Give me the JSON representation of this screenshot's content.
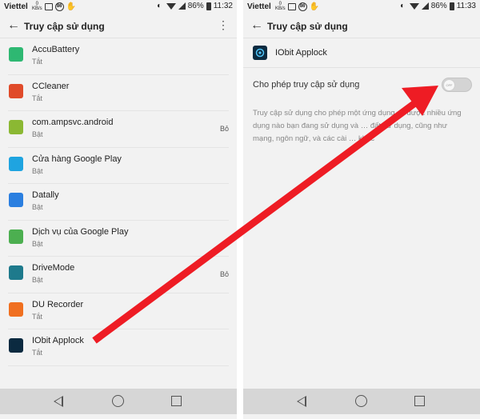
{
  "left_screen": {
    "status": {
      "carrier": "Viettel",
      "speed_value": "0",
      "speed_unit": "KB/s",
      "battery": "86%",
      "time": "11:32"
    },
    "toolbar": {
      "title": "Truy cập sử dụng",
      "menu_glyph": "⋮"
    },
    "apps": [
      {
        "name": "AccuBattery",
        "status": "Tắt",
        "trailing": "",
        "icon": "battery-icon",
        "color": "#2eb872"
      },
      {
        "name": "CCleaner",
        "status": "Tắt",
        "trailing": "",
        "icon": "ccleaner-icon",
        "color": "#e04b2a"
      },
      {
        "name": "com.ampsvc.android",
        "status": "Bật",
        "trailing": "Bỏ",
        "icon": "android-icon",
        "color": "#8bb833"
      },
      {
        "name": "Cửa hàng Google Play",
        "status": "Bật",
        "trailing": "",
        "icon": "google-play-icon",
        "color": "#1fa4e0"
      },
      {
        "name": "Datally",
        "status": "Bật",
        "trailing": "",
        "icon": "datally-icon",
        "color": "#2b7fe0"
      },
      {
        "name": "Dịch vụ của Google Play",
        "status": "Bật",
        "trailing": "",
        "icon": "puzzle-icon",
        "color": "#4caf50"
      },
      {
        "name": "DriveMode",
        "status": "Bật",
        "trailing": "Bỏ",
        "icon": "car-icon",
        "color": "#1e7a8c"
      },
      {
        "name": "DU Recorder",
        "status": "Tắt",
        "trailing": "",
        "icon": "recorder-icon",
        "color": "#f07020"
      },
      {
        "name": "IObit Applock",
        "status": "Tắt",
        "trailing": "",
        "icon": "applock-icon",
        "color": "#0b2a40"
      }
    ]
  },
  "right_screen": {
    "status": {
      "carrier": "Viettel",
      "speed_value": "0",
      "speed_unit": "KB/s",
      "battery": "86%",
      "time": "11:33"
    },
    "toolbar": {
      "title": "Truy cập sử dụng"
    },
    "app_name": "IObit Applock",
    "permission_label": "Cho phép truy cập sử dụng",
    "toggle_state": "OFF",
    "description": "Truy cập sử dụng cho phép một ứng dụng … được nhiều ứng dụng nào bạn đang sử dụng và … đất sử dụng, cũng như mạng, ngôn ngữ, và các cài … khác"
  },
  "colors": {
    "arrow": "#ee1c24",
    "background": "#f2f2f2",
    "navbar": "#d6d6d6"
  }
}
